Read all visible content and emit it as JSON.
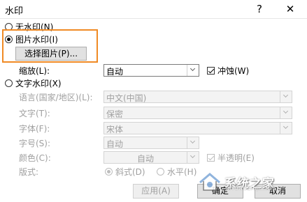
{
  "dialog": {
    "title": "水印",
    "help_btn": "?",
    "close_btn": "✕"
  },
  "options": {
    "none_label": "无水印(N)",
    "picture_label": "图片水印(I)",
    "select_picture_btn": "选择图片(P)...",
    "scale_label": "缩放(L):",
    "scale_value": "自动",
    "washout_label": "冲蚀(W)",
    "washout_checked": true,
    "text_label": "文字水印(X)"
  },
  "text_settings": {
    "language_label": "语言(国家/地区)(L):",
    "language_value": "中文(中国)",
    "text_label": "文字(T):",
    "text_value": "保密",
    "font_label": "字体(F):",
    "font_value": "宋体",
    "size_label": "字号(S):",
    "size_value": "自动",
    "color_label": "颜色(C):",
    "color_value": "自动",
    "semitransparent_label": "半透明(E)",
    "layout_label": "版式:",
    "diagonal_label": "斜式(D)",
    "horizontal_label": "水平(H)"
  },
  "footer": {
    "apply_btn": "应用(A)",
    "ok_btn": "确定",
    "cancel_btn": "取消"
  },
  "watermark_overlay": {
    "text": "系统之家",
    "url": "XITONGZHIJIA.NET"
  },
  "colors": {
    "highlight": "#f08a24",
    "disabled_text": "#a0a0a0"
  }
}
